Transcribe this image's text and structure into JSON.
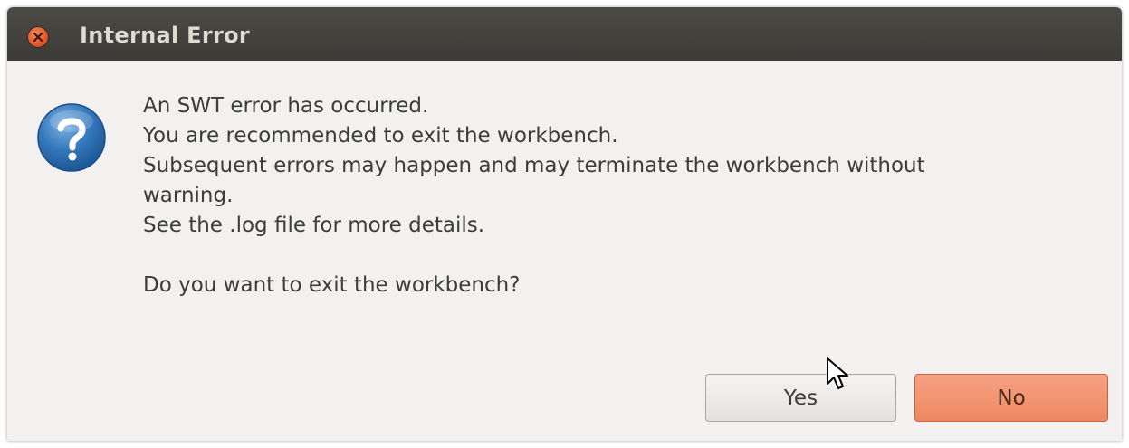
{
  "dialog": {
    "title": "Internal Error",
    "icon": "question-icon",
    "message_lines": [
      "An SWT error has occurred.",
      "You are recommended to exit the workbench.",
      "Subsequent errors may happen and may terminate the workbench without",
      "warning.",
      "See the .log file for more details."
    ],
    "question": "Do you want to exit the workbench?",
    "buttons": {
      "yes_label": "Yes",
      "no_label": "No"
    }
  },
  "colors": {
    "titlebar": "#3c3b37",
    "title_text": "#dfdbd2",
    "dialog_bg": "#f2f1f0",
    "close_button": "#e35a2a",
    "default_button": "#ee8961",
    "question_icon": "#2b6fb0"
  }
}
